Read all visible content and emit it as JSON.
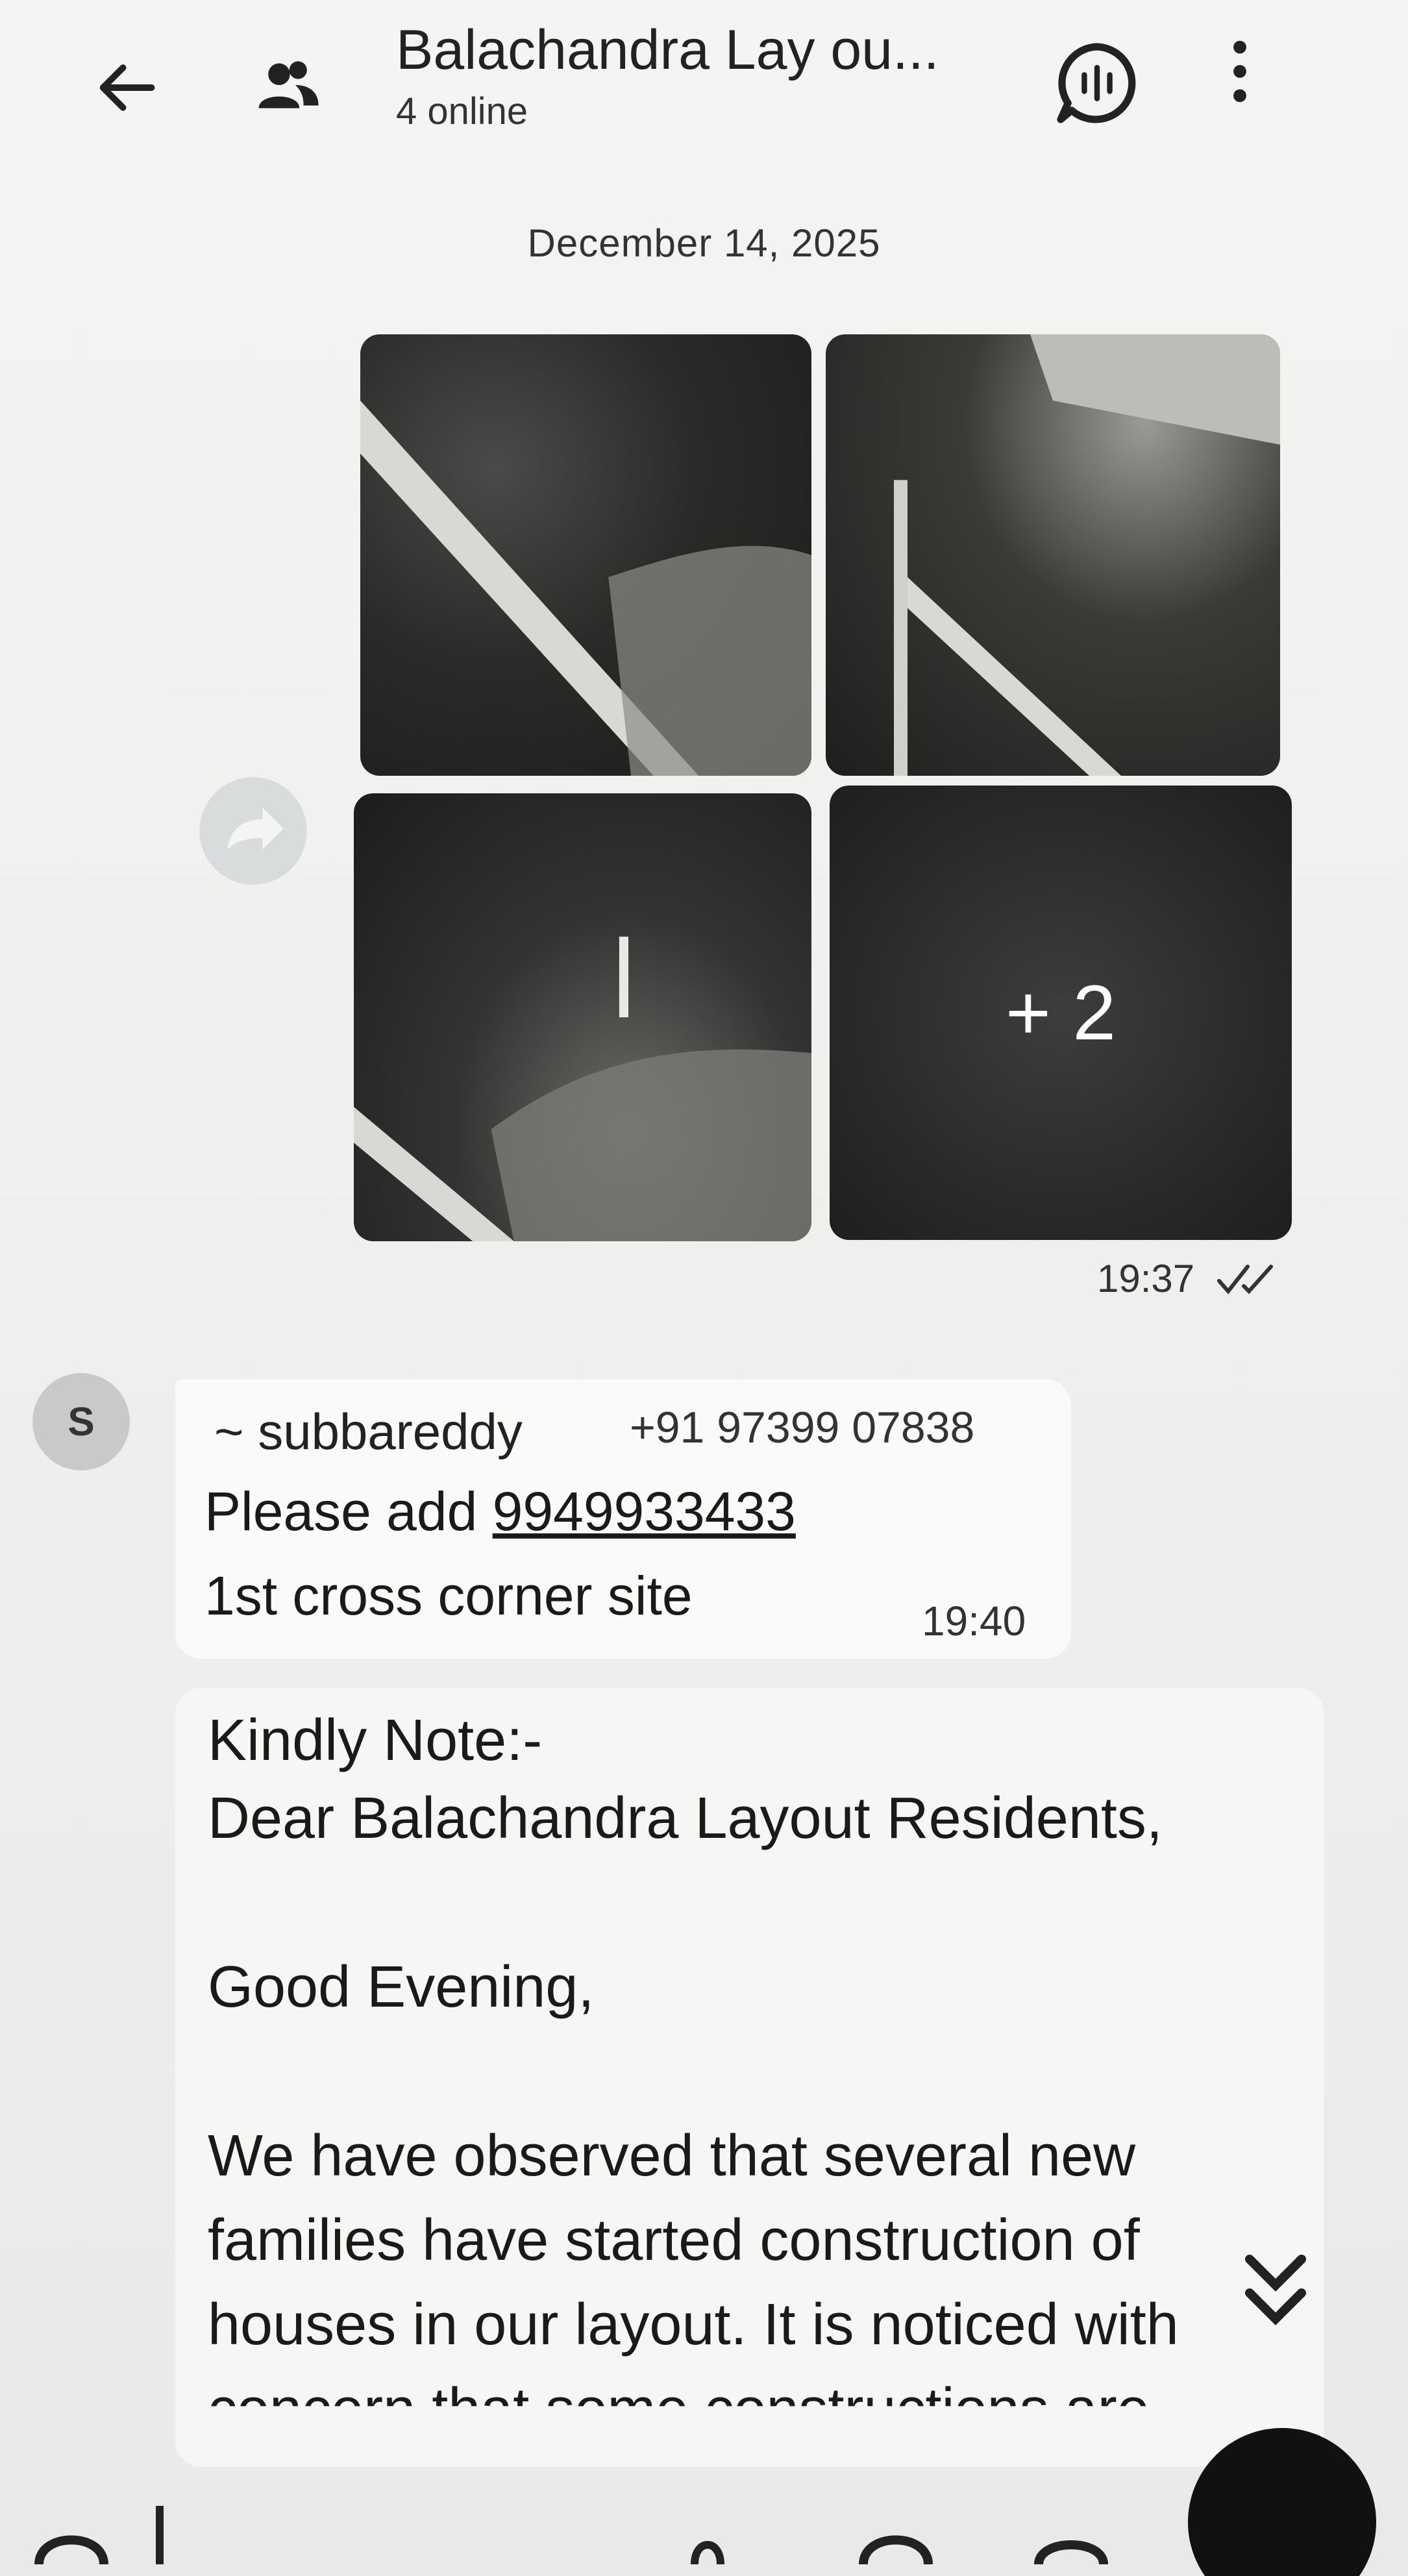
{
  "header": {
    "title": "Balachandra Lay ou...",
    "status": "4 online",
    "icons": [
      "back-arrow-icon",
      "group-icon",
      "voice-chat-icon",
      "more-vert-icon"
    ]
  },
  "date_divider": "December 14, 2025",
  "media_message": {
    "extra_count": "+ 2",
    "time": "19:37",
    "status_icon": "double-check-icon"
  },
  "reply_message": {
    "avatar_letter": "S",
    "sender": "~ subbareddy",
    "sender_phone": "+91 97399 07838",
    "line1_prefix": "Please add ",
    "line1_link": "9949933433",
    "line2": "1st cross corner site",
    "time": "19:40"
  },
  "notice_message": {
    "lines": [
      "Kindly Note:-",
      "Dear Balachandra Layout Residents,",
      "",
      "Good Evening,",
      "",
      "We have observed that several new",
      "families have started construction of",
      "houses in our layout. It is noticed with",
      "concern that some constructions are"
    ]
  },
  "colors": {
    "background": "#f1f1ef",
    "bubble": "#fafaf9",
    "text": "#1c1c1c",
    "fab": "#111111"
  }
}
